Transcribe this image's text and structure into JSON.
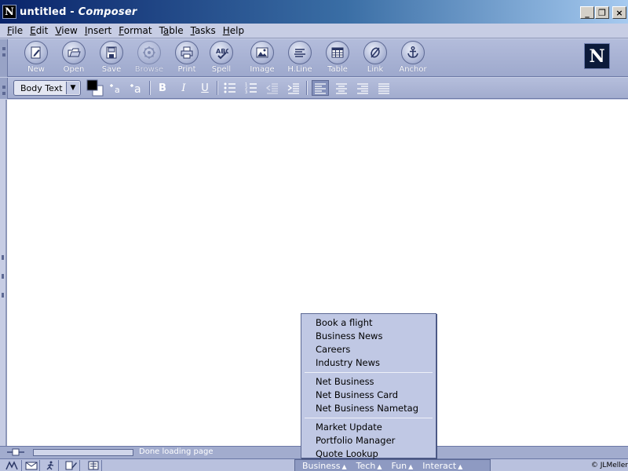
{
  "window": {
    "title_doc": "untitled",
    "title_sep": " - ",
    "title_app": "Composer",
    "app_icon_letter": "N",
    "min_glyph": "_",
    "max_glyph": "❐",
    "close_glyph": "×"
  },
  "menubar": {
    "items": [
      {
        "key": "F",
        "rest": "ile"
      },
      {
        "key": "E",
        "rest": "dit"
      },
      {
        "key": "V",
        "rest": "iew"
      },
      {
        "key": "I",
        "rest": "nsert"
      },
      {
        "key": "F",
        "rest": "ormat",
        "pre": ""
      },
      {
        "key": "a",
        "pre": "T",
        "rest": "ble"
      },
      {
        "key": "T",
        "rest": "asks"
      },
      {
        "key": "H",
        "rest": "elp"
      }
    ]
  },
  "toolbar": {
    "buttons": [
      "New",
      "Open",
      "Save",
      "Browse",
      "Print",
      "Spell",
      "Image",
      "H.Line",
      "Table",
      "Link",
      "Anchor"
    ],
    "logo_letter": "N"
  },
  "format_toolbar": {
    "paragraph_style": "Body Text",
    "bold": "B",
    "italic": "I",
    "underline": "U"
  },
  "status": {
    "text": "Done loading page",
    "progress": 0
  },
  "bottom_tabs": [
    "Business",
    "Tech",
    "Fun",
    "Interact"
  ],
  "copyright": "© JLMeller",
  "popup_menu": {
    "groups": [
      [
        "Book a flight",
        "Business News",
        "Careers",
        "Industry News"
      ],
      [
        "Net Business",
        "Net Business Card",
        "Net Business Nametag"
      ],
      [
        "Market Update",
        "Portfolio Manager",
        "Quote Lookup"
      ]
    ]
  },
  "colors": {
    "titlebar_start": "#0a246a",
    "chrome": "#c7cde4",
    "toolbar": "#a2acce",
    "accent": "#5d6994"
  },
  "icons": {
    "toolbar": [
      "new-icon",
      "open-icon",
      "save-icon",
      "browse-icon",
      "print-icon",
      "spell-icon",
      "image-icon",
      "hline-icon",
      "table-icon",
      "link-icon",
      "anchor-icon"
    ]
  }
}
